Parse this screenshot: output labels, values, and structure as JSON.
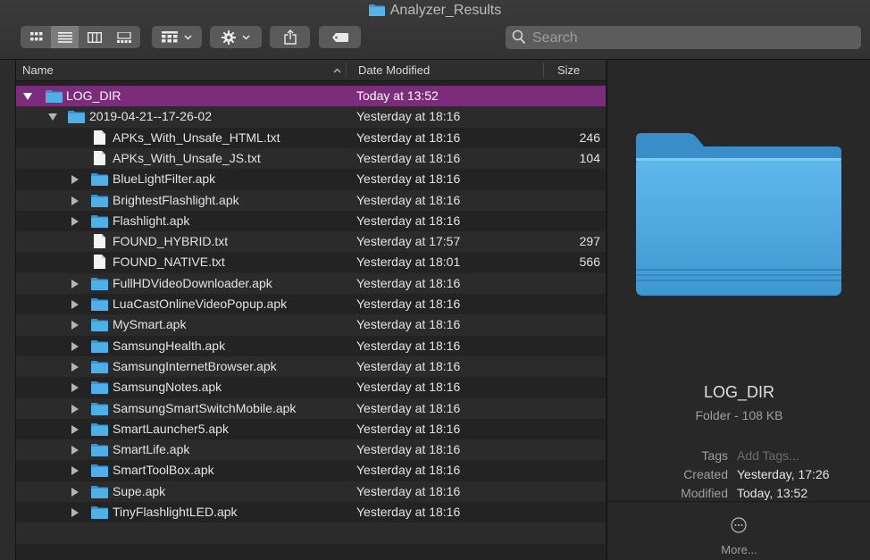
{
  "window": {
    "title": "Analyzer_Results"
  },
  "search": {
    "placeholder": "Search",
    "value": ""
  },
  "columns": {
    "name": "Name",
    "date": "Date Modified",
    "size": "Size"
  },
  "rows": [
    {
      "name": "LOG_DIR",
      "date": "Today at 13:52",
      "size": "",
      "kind": "folder",
      "level": 0,
      "disclosure": "open",
      "selected": true
    },
    {
      "name": "2019-04-21--17-26-02",
      "date": "Yesterday at 18:16",
      "size": "",
      "kind": "folder",
      "level": 1,
      "disclosure": "open"
    },
    {
      "name": "APKs_With_Unsafe_HTML.txt",
      "date": "Yesterday at 18:16",
      "size": "246",
      "kind": "file",
      "level": 2,
      "disclosure": "none"
    },
    {
      "name": "APKs_With_Unsafe_JS.txt",
      "date": "Yesterday at 18:16",
      "size": "104",
      "kind": "file",
      "level": 2,
      "disclosure": "none"
    },
    {
      "name": "BlueLightFilter.apk",
      "date": "Yesterday at 18:16",
      "size": "",
      "kind": "folder",
      "level": 2,
      "disclosure": "closed"
    },
    {
      "name": "BrightestFlashlight.apk",
      "date": "Yesterday at 18:16",
      "size": "",
      "kind": "folder",
      "level": 2,
      "disclosure": "closed"
    },
    {
      "name": "Flashlight.apk",
      "date": "Yesterday at 18:16",
      "size": "",
      "kind": "folder",
      "level": 2,
      "disclosure": "closed"
    },
    {
      "name": "FOUND_HYBRID.txt",
      "date": "Yesterday at 17:57",
      "size": "297",
      "kind": "file",
      "level": 2,
      "disclosure": "none"
    },
    {
      "name": "FOUND_NATIVE.txt",
      "date": "Yesterday at 18:01",
      "size": "566",
      "kind": "file",
      "level": 2,
      "disclosure": "none"
    },
    {
      "name": "FullHDVideoDownloader.apk",
      "date": "Yesterday at 18:16",
      "size": "",
      "kind": "folder",
      "level": 2,
      "disclosure": "closed"
    },
    {
      "name": "LuaCastOnlineVideoPopup.apk",
      "date": "Yesterday at 18:16",
      "size": "",
      "kind": "folder",
      "level": 2,
      "disclosure": "closed"
    },
    {
      "name": "MySmart.apk",
      "date": "Yesterday at 18:16",
      "size": "",
      "kind": "folder",
      "level": 2,
      "disclosure": "closed"
    },
    {
      "name": "SamsungHealth.apk",
      "date": "Yesterday at 18:16",
      "size": "",
      "kind": "folder",
      "level": 2,
      "disclosure": "closed"
    },
    {
      "name": "SamsungInternetBrowser.apk",
      "date": "Yesterday at 18:16",
      "size": "",
      "kind": "folder",
      "level": 2,
      "disclosure": "closed"
    },
    {
      "name": "SamsungNotes.apk",
      "date": "Yesterday at 18:16",
      "size": "",
      "kind": "folder",
      "level": 2,
      "disclosure": "closed"
    },
    {
      "name": "SamsungSmartSwitchMobile.apk",
      "date": "Yesterday at 18:16",
      "size": "",
      "kind": "folder",
      "level": 2,
      "disclosure": "closed"
    },
    {
      "name": "SmartLauncher5.apk",
      "date": "Yesterday at 18:16",
      "size": "",
      "kind": "folder",
      "level": 2,
      "disclosure": "closed"
    },
    {
      "name": "SmartLife.apk",
      "date": "Yesterday at 18:16",
      "size": "",
      "kind": "folder",
      "level": 2,
      "disclosure": "closed"
    },
    {
      "name": "SmartToolBox.apk",
      "date": "Yesterday at 18:16",
      "size": "",
      "kind": "folder",
      "level": 2,
      "disclosure": "closed"
    },
    {
      "name": "Supe.apk",
      "date": "Yesterday at 18:16",
      "size": "",
      "kind": "folder",
      "level": 2,
      "disclosure": "closed"
    },
    {
      "name": "TinyFlashlightLED.apk",
      "date": "Yesterday at 18:16",
      "size": "",
      "kind": "folder",
      "level": 2,
      "disclosure": "closed"
    }
  ],
  "preview": {
    "name": "LOG_DIR",
    "kind": "Folder - 108 KB",
    "tags_label": "Tags",
    "tags_placeholder": "Add Tags...",
    "created_label": "Created",
    "created_value": "Yesterday, 17:26",
    "modified_label": "Modified",
    "modified_value": "Today, 13:52",
    "more_label": "More..."
  },
  "colors": {
    "selection": "#7b2c7b",
    "folder": "#4aa3dc"
  }
}
